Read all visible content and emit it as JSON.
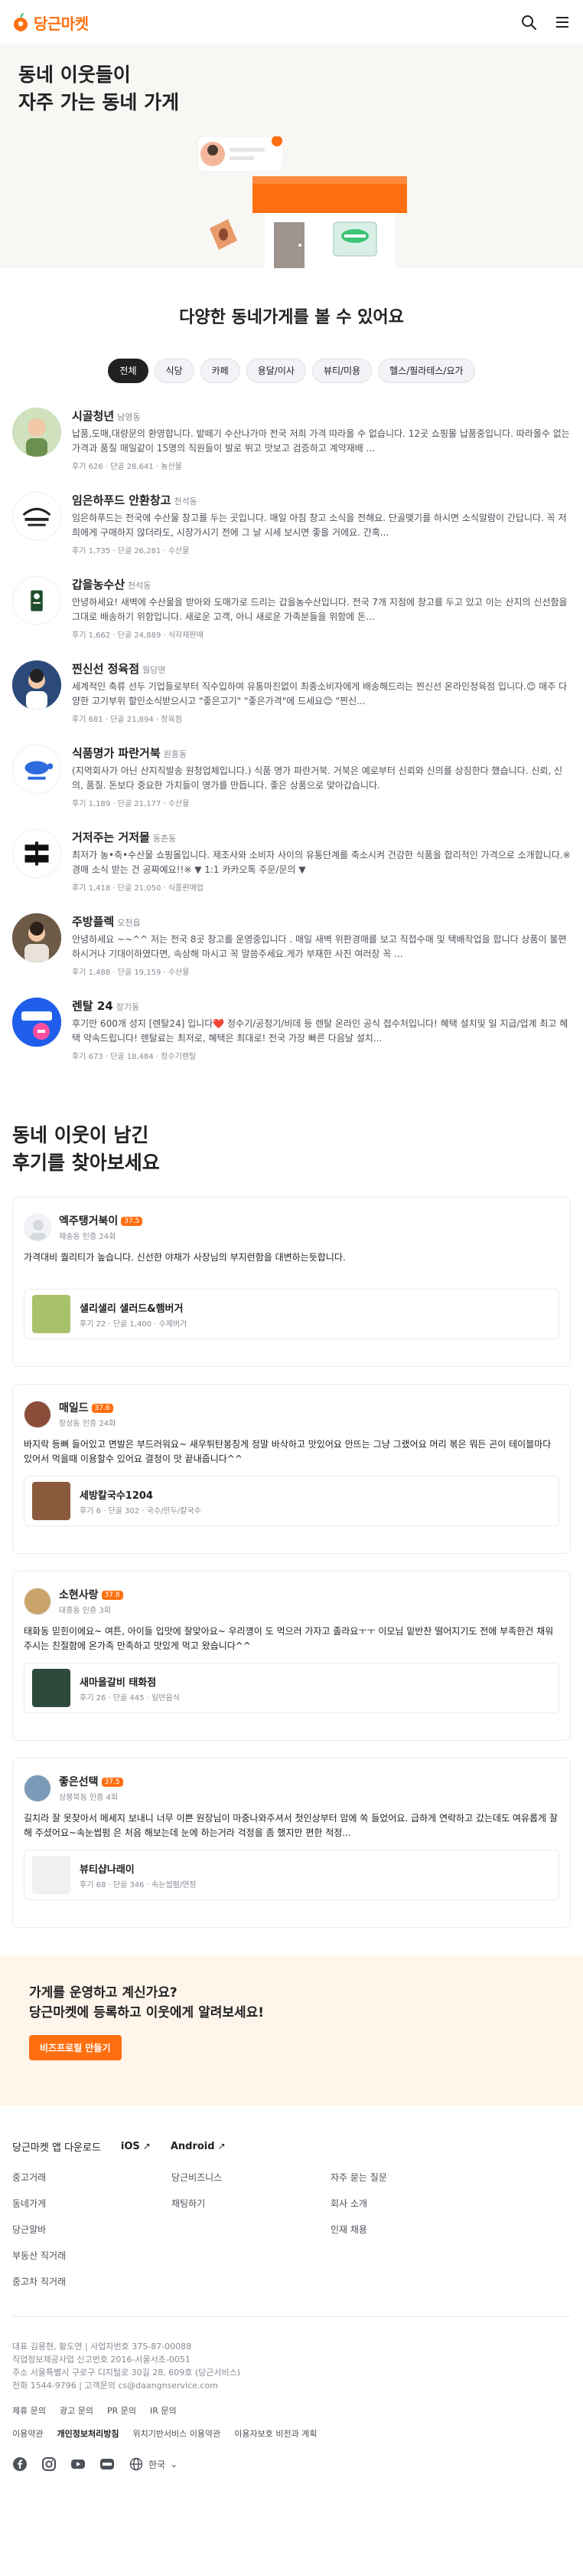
{
  "header": {
    "brand": "당근마켓"
  },
  "hero": {
    "title": "동네 이웃들이\n자주 가는 동네 가게"
  },
  "stores_section": {
    "title": "다양한 동네가게를 볼 수 있어요",
    "chips": [
      {
        "label": "전체",
        "active": true
      },
      {
        "label": "식당",
        "active": false
      },
      {
        "label": "카페",
        "active": false
      },
      {
        "label": "용달/이사",
        "active": false
      },
      {
        "label": "뷰티/미용",
        "active": false
      },
      {
        "label": "헬스/필라테스/요가",
        "active": false
      }
    ],
    "stores": [
      {
        "name": "시골청년",
        "loc": "남영동",
        "desc": "납품,도매,대량문의 환영합니다. 밭떼기 수산나가마 전국 저희 가격 따라올 수 없습니다. 12곳 쇼핑몰 납품중입니다. 따라올수 없는 가격과 품질 매일같이 15명의 직원들이 발로 뛰고 맛보고 검증하고 계약재배 ...",
        "meta": "후기 626 · 단골 28,641 · 농산물"
      },
      {
        "name": "임은하푸드 안환창고",
        "loc": "천석동",
        "desc": "임은하푸드는 전국에 수산물 창고를 두는 곳입니다. 매일 아침 창고 소식을 전해요. 단골맺기를 하시면 소식알람이 간답니다. 꼭 저희에게 구매하지 않더라도, 시장가시기 전에 그 날 시세 보시면 좋을 거에요. 간혹...",
        "meta": "후기 1,735 · 단골 26,281 · 수산물"
      },
      {
        "name": "갑을농수산",
        "loc": "천석동",
        "desc": "안녕하세요! 새벽에 수산물을 받아와 도매가로 드리는 갑을농수산입니다. 전국 7개 지점에 창고를 두고 있고 이는 산지의 신선함을 그대로 배송하기 위함입니다. 새로운 고객, 아니 새로운 가족분들을 위함에 돈...",
        "meta": "후기 1,662 · 단골 24,889 · 식자재판매"
      },
      {
        "name": "찐신선 정육점",
        "loc": "월당면",
        "desc": "세계적인 축류 선두 기업들로부터 직수입하여 유통마진없이 최종소비자에게 배송해드리는 찐신선 온라인정육점 입니다.😊 매주 다양한 고기부위 할인소식받으시고 \"좋은고기\" \"좋은가격\"에 드세요😊 \"찐신...",
        "meta": "후기 681 · 단골 21,894 · 정육점"
      },
      {
        "name": "식품명가 파란거북",
        "loc": "원흥동",
        "desc": "(지역회사가 아닌 산지직발송 원청업체입니다.) 식품 명가 파란거북. 거북은 예로부터 신뢰와 신의를 상징한다 했습니다. 신뢰, 신의, 품질. 돈보다 중요한 가치들이 명가를 만듭니다. 좋은 상품으로 맞아갑습니다.",
        "meta": "후기 1,189 · 단골 21,177 · 수산물"
      },
      {
        "name": "거저주는 거저몰",
        "loc": "동촌동",
        "desc": "최저가 농•축•수산물 쇼핑몰입니다. 제조사와 소비자 사이의 유통단계를 축소시켜 건강한 식품을 합리적인 가격으로 소개합니다.※경매 소식 받는 건 공짜예요!!※ ▼ 1:1 카카오톡 주문/문의 ▼",
        "meta": "후기 1,418 · 단골 21,050 · 식품판매업"
      },
      {
        "name": "주방플렉",
        "loc": "오천읍",
        "desc": "안녕하세요 ~~^^ 저는 전국 8곳 창고를 운영중입니다 . 매일 새벽 위판경매를 보고 직접수매 및 택배작업을 합니다 상품이 불편하시거나 기대이하였다면, 속상해 마시고 꼭 말씀주세요.게가 부재한 사진 여러장 꼭 ...",
        "meta": "후기 1,488 · 단골 19,159 · 수산물"
      },
      {
        "name": "렌탈 24",
        "loc": "장기동",
        "desc": "후기만 600개 성지 [렌탈24] 입니다❤️ 정수기/공청기/비데 등 렌탈 온라인 공식 접수처입니다! 혜택 설치및 일 지급/업계 최고 혜택 약속드립니다! 렌탈료는 최저로, 혜택은 최대로! 전국 가장 빠른 다음날 설치...",
        "meta": "후기 673 · 단골 18,484 · 정수기렌탈"
      }
    ]
  },
  "reviews_section": {
    "title": "동네 이웃이 남긴\n후기를 찾아보세요",
    "reviews": [
      {
        "name": "엑주탱거북이",
        "temp": "37.5",
        "sub": "재송동 인증 24회",
        "text": "가격대비 퀄리티가 높습니다. 신선한 야채가 사장님의 부지런함을 대변하는듯합니다.",
        "store": "샐리샐리 샐러드&햄버거",
        "store_meta": "후기 22 · 단골 1,400 · 수제버거"
      },
      {
        "name": "매일드",
        "temp": "37.6",
        "sub": "장성동 인증 24회",
        "text": "바지락 등뼈 들어있고 면발은 부드러워요~ 새우튀탄봉칭게 정말 바삭하고 맛있어요 안뜨는 그냥 그랬어요 머리 볶은 뭐든 곤이 테이블마다 있어서 먹을때 이용할수 있어요 결정이 맛 끝내줍니다^^",
        "store": "세방칼국수1204",
        "store_meta": "후기 6 · 단골 302 · 국수/만두/칼국수"
      },
      {
        "name": "소현사랑",
        "temp": "37.8",
        "sub": "대흥동 인증 3회",
        "text": "태화동 믿힌이에요~ 여튼, 아이들 입맛에 잘맞아요~ 우리꼉이 도 먹으러 가자고 졸라요ㅜㅜ 이모님 밑반찬 떨어지기도 전에 부족한건 채워주시는 친절함에 온가족 만족하고 맛있게 먹고 왔습니다^^",
        "store": "새마을갈비 태화점",
        "store_meta": "후기 26 · 단골 445 · 일반음식"
      },
      {
        "name": "좋은선택",
        "temp": "37.5",
        "sub": "상봉북동 인증 4회",
        "text": "길치라 잘 못찾아서 메세지 보내니 너무 이쁜 원장님이 마중나와주셔서 첫인상부터 맘에 쏙 들었어요. 급하게 연락하고 갔는데도 여유롭게 잘 해 주셨어요~속눈썹펌 은 처음 해보는데 눈에 하는거라 걱정을 좀 했지만 편한 적정...",
        "store": "뷰티샵나래이",
        "store_meta": "후기 68 · 단골 346 · 속눈썹펌/연장"
      }
    ]
  },
  "cta": {
    "title": "가게를 운영하고 계신가요?\n당근마켓에 등록하고 이웃에게 알려보세요!",
    "button": "비즈프로필 만들기"
  },
  "footer": {
    "app_download": "당근마켓 앱 다운로드",
    "ios": "iOS",
    "android": "Android",
    "links": [
      "중고거래",
      "당근비즈니스",
      "자주 묻는 질문",
      "동네가게",
      "채팅하기",
      "회사 소개",
      "당근알바",
      "",
      "인재 채용",
      "부동산 직거래",
      "",
      "",
      "중고차 직거래",
      "",
      ""
    ],
    "company": "대표 김용현, 황도연 | 사업자번호 375-87-00088\n직업정보제공사업 신고번호 2016-서울서초-0051\n주소 서울특별시 구로구 디지털로 30길 28, 609호 (당근서비스)\n전화 1544-9796 | 고객문의 cs@daangnservice.com",
    "policy": [
      "제휴 문의",
      "광고 문의",
      "PR 문의",
      "IR 문의"
    ],
    "policy2": [
      "이용약관",
      "개인정보처리방침",
      "위치기반서비스 이용약관",
      "이용자보호 비전과 계획"
    ],
    "language": "한국"
  },
  "colors": {
    "brand": "#ff6f0f",
    "text": "#212124",
    "sub": "#868b94"
  },
  "icons": [
    "carrot-logo-icon",
    "search-icon",
    "menu-icon",
    "facebook-icon",
    "instagram-icon",
    "youtube-icon",
    "blog-icon",
    "globe-icon",
    "chevron-down-icon",
    "external-arrow-icon"
  ]
}
